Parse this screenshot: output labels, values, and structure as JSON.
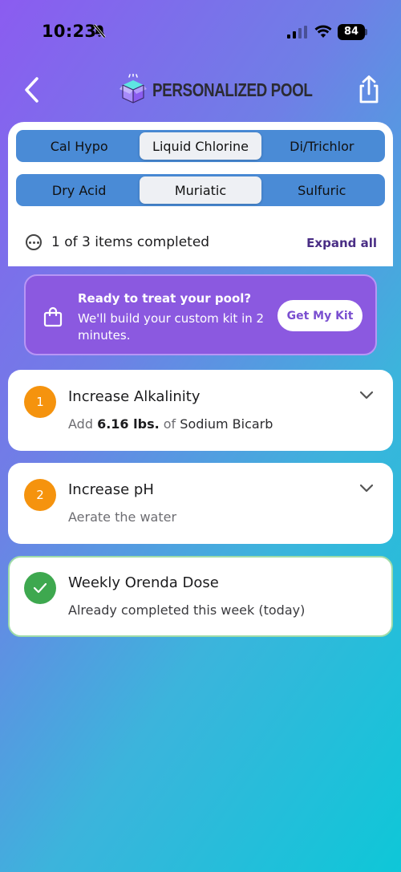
{
  "status": {
    "time": "10:23",
    "battery": "84"
  },
  "header": {
    "brand": "PERSONALIZED POOL"
  },
  "chlorine_tabs": [
    {
      "label": "Cal Hypo",
      "active": false
    },
    {
      "label": "Liquid Chlorine",
      "active": true
    },
    {
      "label": "Di/Trichlor",
      "active": false
    }
  ],
  "acid_tabs": [
    {
      "label": "Dry Acid",
      "active": false
    },
    {
      "label": "Muriatic",
      "active": true
    },
    {
      "label": "Sulfuric",
      "active": false
    }
  ],
  "progress": {
    "text": "1 of 3 items completed",
    "expand_label": "Expand all"
  },
  "promo": {
    "title": "Ready to treat your pool?",
    "body": "We'll build your custom kit in 2 minutes.",
    "button": "Get My Kit"
  },
  "items": [
    {
      "number": "1",
      "title": "Increase Alkalinity",
      "sub_prefix": "Add",
      "sub_amount": "6.16 lbs.",
      "sub_of": "of",
      "sub_product": "Sodium Bicarb"
    },
    {
      "number": "2",
      "title": "Increase pH",
      "sub": "Aerate the water"
    },
    {
      "title": "Weekly Orenda Dose",
      "sub": "Already completed this week (today)"
    }
  ],
  "colors": {
    "accent_purple": "#8b59e0",
    "segment_blue": "#4a8bd6",
    "badge_orange": "#f5930e",
    "done_green": "#3ea84f"
  }
}
